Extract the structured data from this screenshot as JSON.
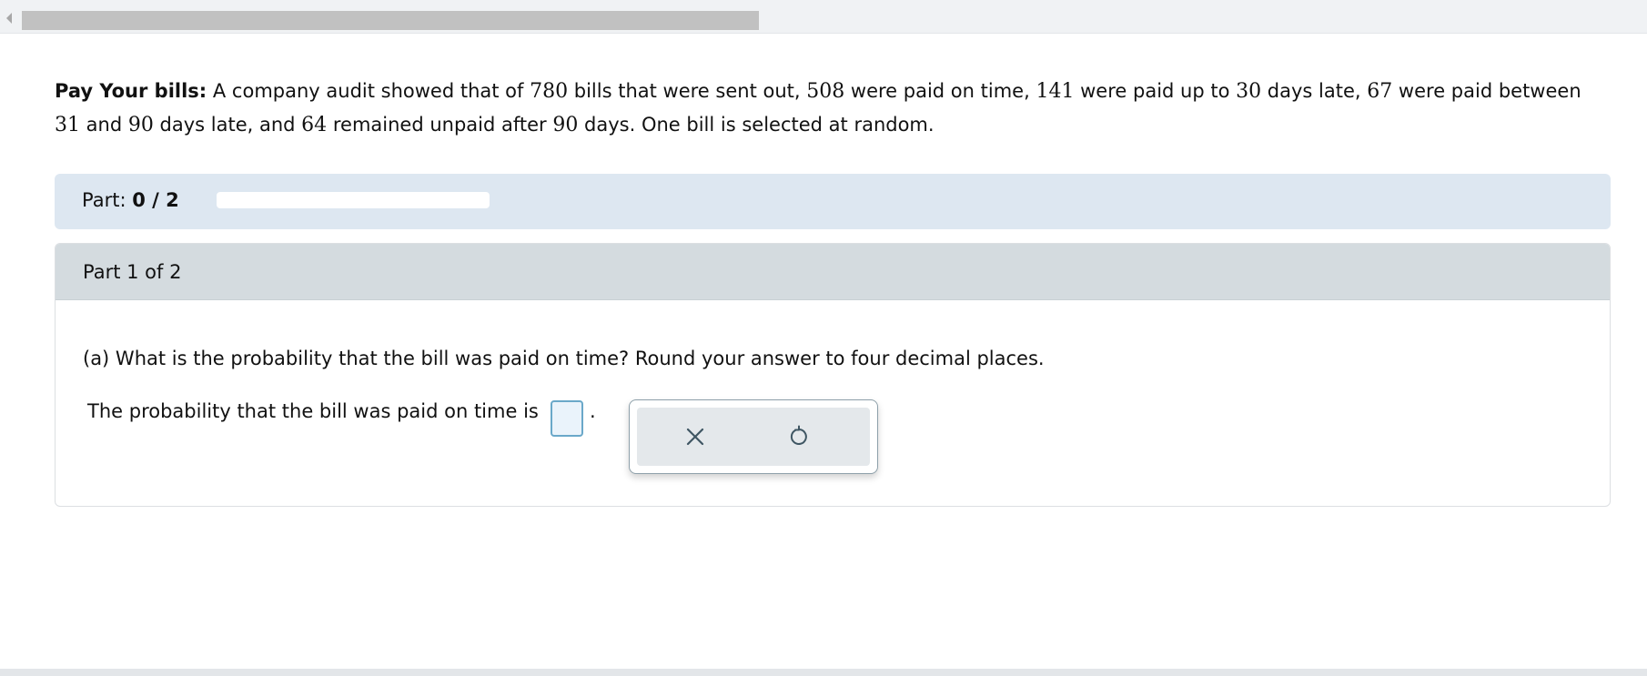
{
  "problem": {
    "title": "Pay Your bills:",
    "s1": "A company audit showed that of ",
    "n1": "780",
    "s2": " bills that were sent out, ",
    "n2": "508",
    "s3": " were paid on time, ",
    "n3": "141",
    "s4": " were paid up to ",
    "n4": "30",
    "s5": " days late, ",
    "n5": "67",
    "s6": " were paid between ",
    "n6": "31",
    "s7": " and ",
    "n7": "90",
    "s8": " days late, and ",
    "n8": "64",
    "s9": " remained unpaid after ",
    "n9": "90",
    "s10": " days. One bill is selected at random."
  },
  "part_progress": {
    "label": "Part:",
    "value": "0 / 2",
    "fraction": 0
  },
  "part": {
    "header": "Part 1 of 2",
    "question": "(a) What is the probability that the bill was paid on time? Round your answer to four decimal places.",
    "answer_prefix": "The probability that the bill was paid on time is",
    "answer_value": "",
    "answer_suffix": "."
  },
  "tools": {
    "clear_icon": "x-icon",
    "undo_icon": "undo-icon"
  },
  "colors": {
    "part_bar": "#dde7f1",
    "part_header": "#d4dbdf",
    "answer_border": "#6aa8c9",
    "icon": "#3f5663"
  }
}
